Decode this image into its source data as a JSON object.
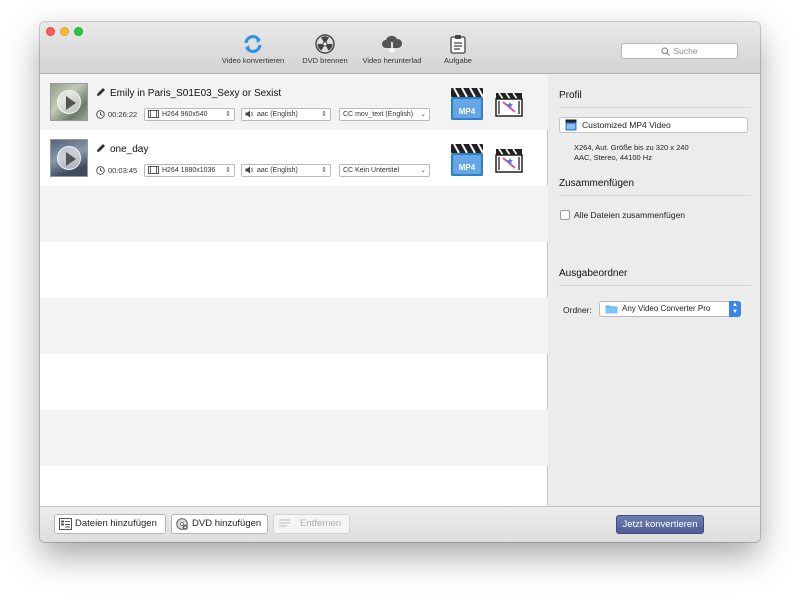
{
  "toolbar": {
    "convert_video": "Video konvertieren",
    "burn_dvd": "DVD brennen",
    "download_video": "Video herunterlad",
    "task": "Aufgabe"
  },
  "search": {
    "placeholder": "Suche"
  },
  "files": [
    {
      "name": "Emily in Paris_S01E03_Sexy or Sexist",
      "duration": "00:26:22",
      "video": "H264 960x540",
      "audio": "aac (English)",
      "subtitle": "mov_text (English)",
      "format": "MP4"
    },
    {
      "name": "one_day",
      "duration": "00:03:45",
      "video": "H264 1880x1036",
      "audio": "aac (English)",
      "subtitle": "Kein Untertitel",
      "format": "MP4"
    }
  ],
  "subtitle_prefix": "CC",
  "panel": {
    "profile_title": "Profil",
    "profile_value": "Customized MP4 Video",
    "profile_desc_line1": "X264, Aut. Größe bis zu 320 x 240",
    "profile_desc_line2": "AAC, Stereo, 44100 Hz",
    "merge_title": "Zusammenfügen",
    "merge_checkbox": "Alle Dateien zusammenfügen",
    "merge_checked": false,
    "output_title": "Ausgabeordner",
    "folder_label": "Ordner:",
    "folder_value": "Any Video Converter Pro"
  },
  "bottom": {
    "add_files": "Dateien hinzufügen",
    "add_dvd": "DVD hinzufügen",
    "remove": "Entfernen",
    "convert_now": "Jetzt konvertieren"
  },
  "colors": {
    "accent_blue": "#3a86e8",
    "convert_button": "#5767a0",
    "toolbar_sync_icon": "#2f8fe8"
  }
}
